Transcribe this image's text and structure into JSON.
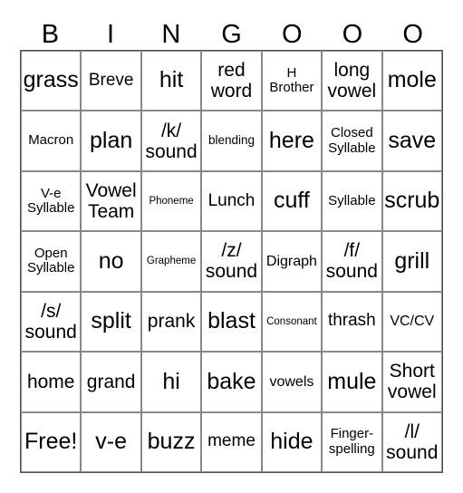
{
  "header": [
    "B",
    "I",
    "N",
    "G",
    "O",
    "O",
    "O"
  ],
  "cells": [
    "grass",
    "Breve",
    "hit",
    "red\nword",
    "H\nBrother",
    "long\nvowel",
    "mole",
    "Macron",
    "plan",
    "/k/\nsound",
    "blending",
    "here",
    "Closed\nSyllable",
    "save",
    "V-e\nSyllable",
    "Vowel\nTeam",
    "Phoneme",
    "Lunch",
    "cuff",
    "Syllable",
    "scrub",
    "Open\nSyllable",
    "no",
    "Grapheme",
    "/z/\nsound",
    "Digraph",
    "/f/\nsound",
    "grill",
    "/s/\nsound",
    "split",
    "prank",
    "blast",
    "Consonant",
    "thrash",
    "VC/CV",
    "home",
    "grand",
    "hi",
    "bake",
    "vowels",
    "mule",
    "Short\nvowel",
    "Free!",
    "v-e",
    "buzz",
    "meme",
    "hide",
    "Finger-\nspelling",
    "/l/\nsound"
  ]
}
